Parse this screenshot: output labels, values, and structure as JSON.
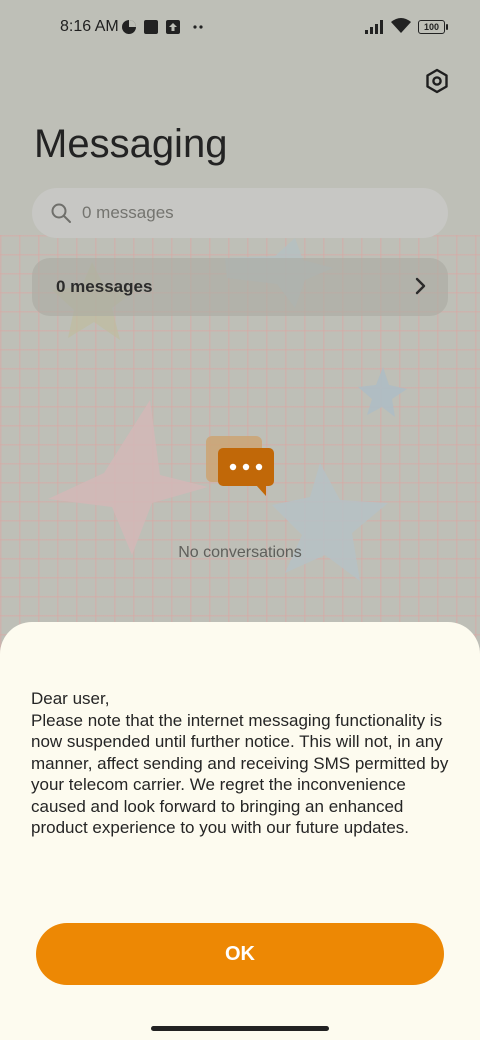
{
  "status_bar": {
    "time": "8:16 AM",
    "battery": "100"
  },
  "header": {
    "title": "Messaging"
  },
  "search": {
    "placeholder": "0 messages"
  },
  "folder": {
    "label": "0 messages"
  },
  "empty_state": {
    "text": "No conversations"
  },
  "dialog": {
    "greeting": "Dear user,",
    "body": "Please note that the internet messaging functionality is now suspended until further notice. This will not, in any manner, affect sending and receiving SMS permitted by your telecom carrier. We regret the inconvenience caused and look forward to bringing an enhanced product experience to you with our future updates.",
    "ok_label": "OK"
  },
  "icons": [
    "data-saver-icon",
    "notification-app-icon",
    "upload-notification-icon",
    "more-notifications-icon",
    "signal-icon",
    "wifi-icon",
    "battery-icon",
    "settings-icon",
    "search-icon",
    "chevron-right-icon",
    "chat-bubbles-icon"
  ],
  "colors": {
    "accent": "#ed8804",
    "sheet": "#fdfbef",
    "scrim_bg": "#bebfb7"
  }
}
